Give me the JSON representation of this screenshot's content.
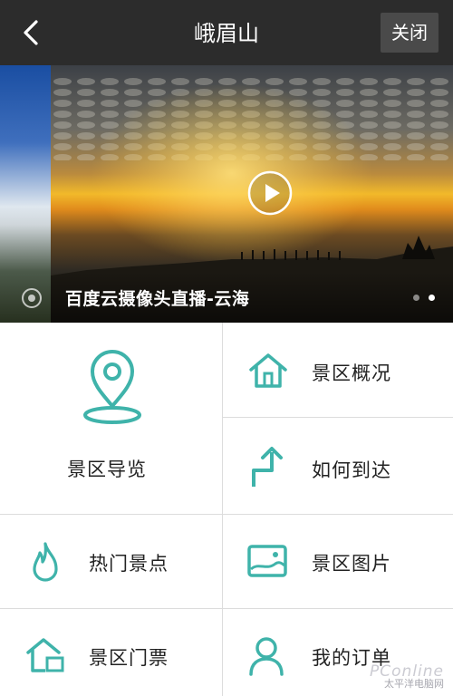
{
  "header": {
    "title": "峨眉山",
    "close_label": "关闭"
  },
  "banner": {
    "caption": "百度云摄像头直播-云海",
    "slide_count": 2,
    "active_slide": 2
  },
  "menu": {
    "guide": {
      "label": "景区导览",
      "icon": "location-pin-icon"
    },
    "overview": {
      "label": "景区概况",
      "icon": "home-icon"
    },
    "directions": {
      "label": "如何到达",
      "icon": "route-arrow-icon"
    },
    "hot_spots": {
      "label": "热门景点",
      "icon": "flame-icon"
    },
    "photos": {
      "label": "景区图片",
      "icon": "picture-icon"
    },
    "tickets": {
      "label": "景区门票",
      "icon": "ticket-house-icon"
    },
    "orders": {
      "label": "我的订单",
      "icon": "user-icon"
    }
  },
  "watermark": {
    "brand": "PConline",
    "site": "太平洋电脑网"
  },
  "colors": {
    "accent": "#3fb3aa",
    "header_bg": "#2c2c2c",
    "divider": "#dcdcdc"
  }
}
